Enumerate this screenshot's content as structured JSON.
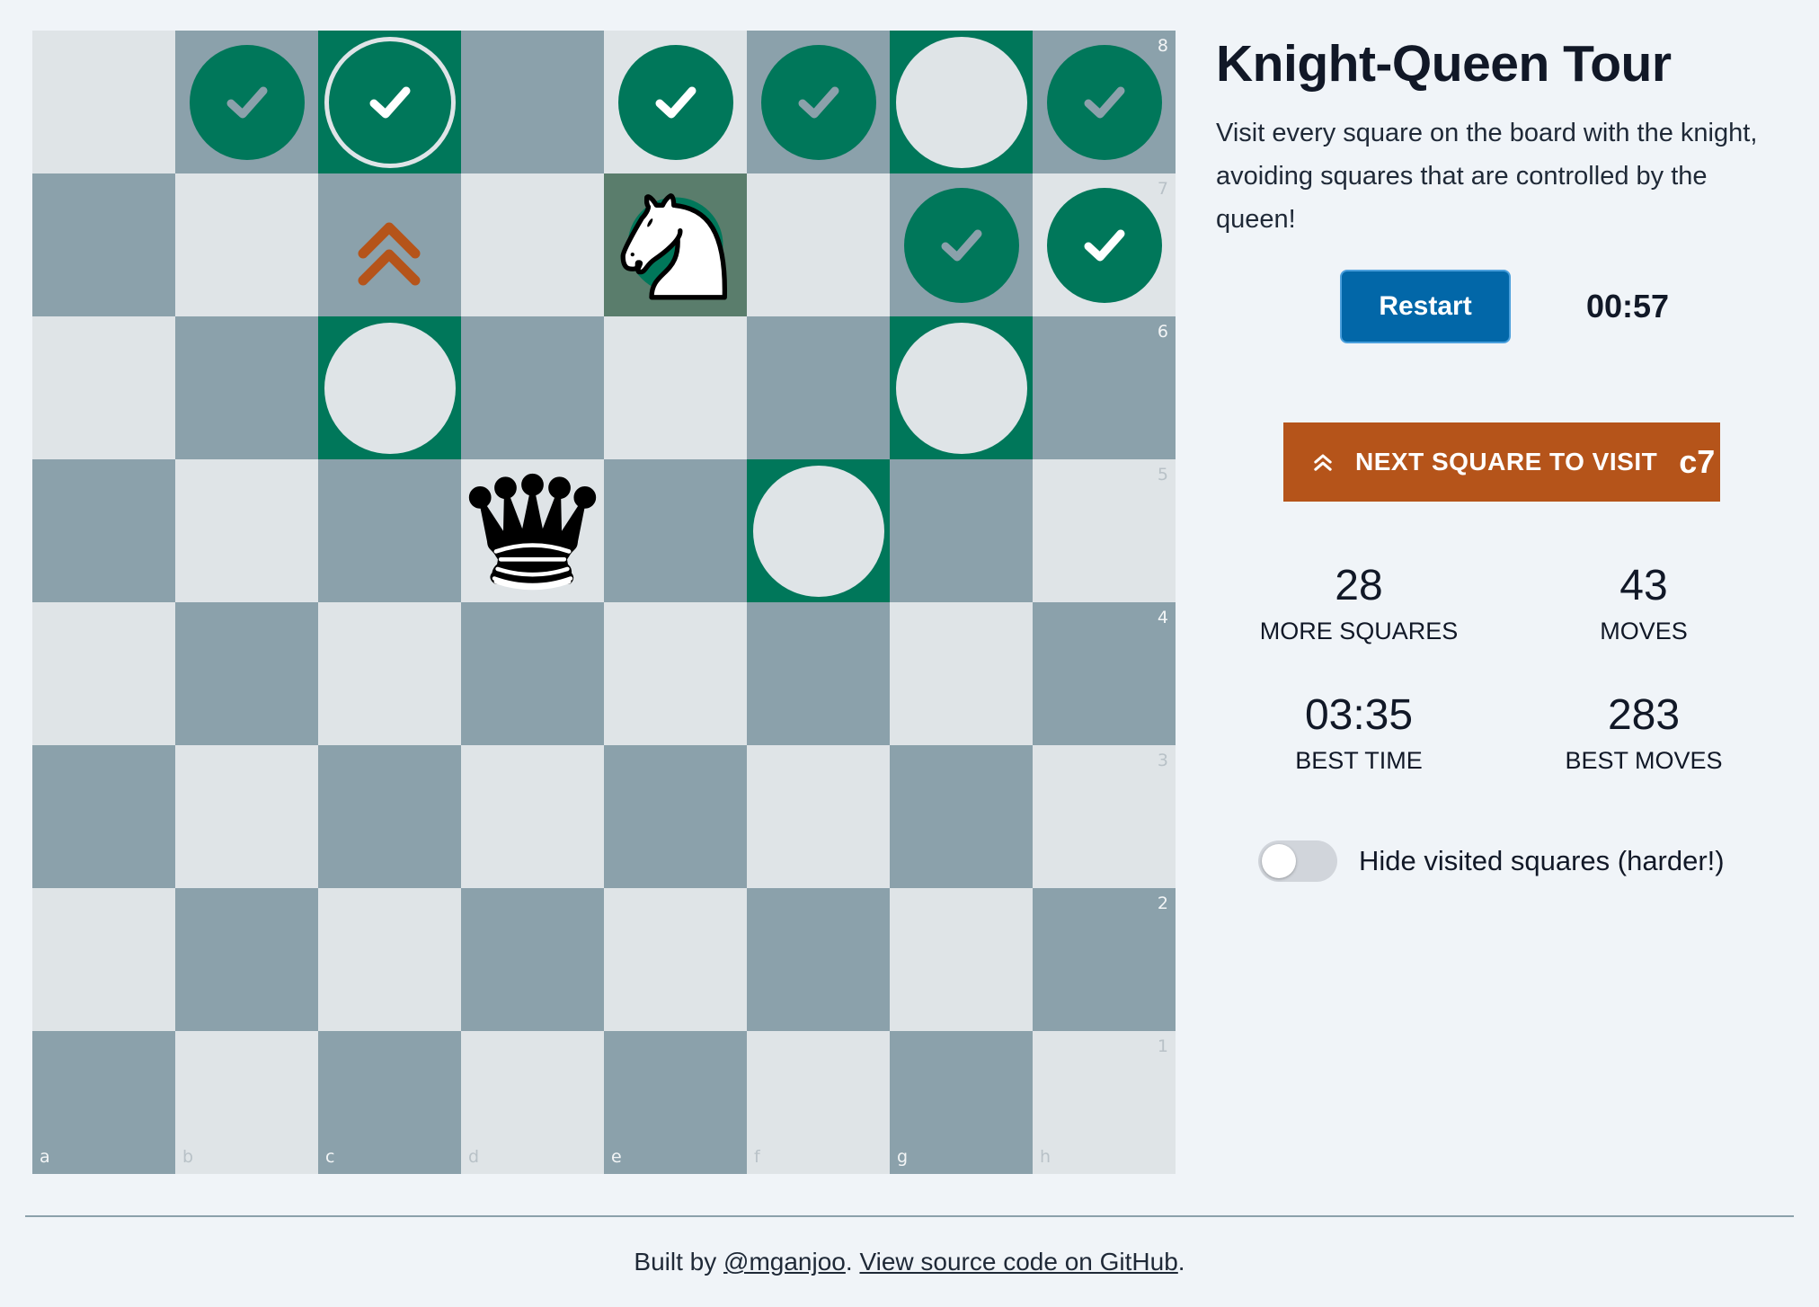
{
  "board": {
    "ranks": [
      "8",
      "7",
      "6",
      "5",
      "4",
      "3",
      "2",
      "1"
    ],
    "files": [
      "a",
      "b",
      "c",
      "d",
      "e",
      "f",
      "g",
      "h"
    ],
    "visited_squares": [
      "b8",
      "c8",
      "e8",
      "f8",
      "h8",
      "g7",
      "h7"
    ],
    "target_squares": [
      "g8",
      "c6",
      "g6",
      "f5"
    ],
    "last_move_square": "c8",
    "next_square_marker": "c7",
    "knight_square": "e7",
    "queen_square": "d5",
    "colors": {
      "light": "#dfe4e7",
      "dark": "#8ba1ab",
      "visited": "#00775a",
      "knight_highlight": "#5a7d6c",
      "next_marker": "#b5541a"
    }
  },
  "panel": {
    "title": "Knight-Queen Tour",
    "description": "Visit every square on the board with the knight, avoiding squares that are controlled by the queen!",
    "restart_label": "Restart",
    "timer": "00:57",
    "next_label": "NEXT SQUARE TO VISIT",
    "next_square": "c7",
    "stats": {
      "more_squares": {
        "value": "28",
        "label": "MORE SQUARES"
      },
      "moves": {
        "value": "43",
        "label": "MOVES"
      },
      "best_time": {
        "value": "03:35",
        "label": "BEST TIME"
      },
      "best_moves": {
        "value": "283",
        "label": "BEST MOVES"
      }
    },
    "hide_visited_label": "Hide visited squares (harder!)",
    "hide_visited_on": false
  },
  "footer": {
    "prefix": "Built by ",
    "author": "@mganjoo",
    "middle": ". ",
    "source_link": "View source code on GitHub",
    "suffix": "."
  }
}
